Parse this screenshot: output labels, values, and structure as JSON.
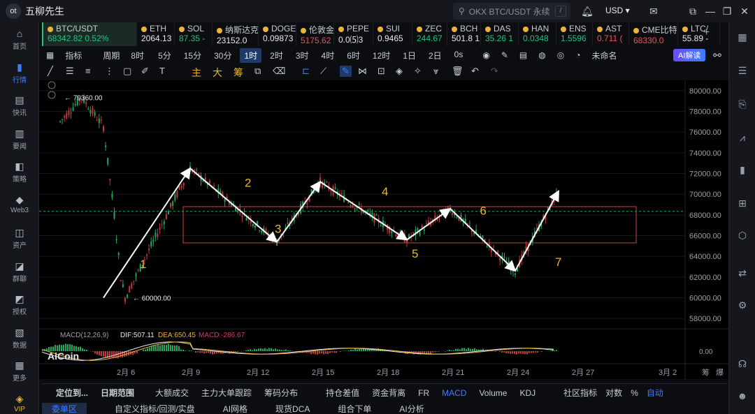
{
  "app": {
    "name": "五柳先生",
    "logo_text": "ot"
  },
  "search": {
    "placeholder": "OKX BTC/USDT 永续",
    "shortcut": "/"
  },
  "currency": "USD ▾",
  "sidebar": [
    {
      "label": "首页",
      "icon": "home-icon"
    },
    {
      "label": "行情",
      "icon": "market-icon",
      "active": true
    },
    {
      "label": "快讯",
      "icon": "news-flash-icon"
    },
    {
      "label": "要闻",
      "icon": "headline-icon"
    },
    {
      "label": "策略",
      "icon": "strategy-icon"
    },
    {
      "label": "Web3",
      "icon": "web3-icon"
    },
    {
      "label": "资产",
      "icon": "assets-icon"
    },
    {
      "label": "群聊",
      "icon": "chat-icon"
    },
    {
      "label": "授权",
      "icon": "authorize-icon"
    },
    {
      "label": "数据",
      "icon": "data-icon"
    },
    {
      "label": "更多",
      "icon": "more-icon"
    },
    {
      "label": "VIP",
      "icon": "vip-icon"
    }
  ],
  "tickers": [
    {
      "sym": "BTC/USDT",
      "price": "68342.82  0.52%",
      "color": "#26c281",
      "selected": true
    },
    {
      "sym": "ETH",
      "price": "2064.13",
      "color": "#e7e9ee"
    },
    {
      "sym": "SOL",
      "price": "87.35 -",
      "color": "#26c281"
    },
    {
      "sym": "纳斯达克",
      "price": "23152.0",
      "color": "#e7e9ee"
    },
    {
      "sym": "DOGE",
      "price": "0.09873",
      "color": "#e7e9ee"
    },
    {
      "sym": "伦敦金",
      "price": "5175.62",
      "color": "#f0505a"
    },
    {
      "sym": "PEPE",
      "price": "0.0⑸3",
      "color": "#e7e9ee"
    },
    {
      "sym": "SUI",
      "price": "0.9465",
      "color": "#e7e9ee"
    },
    {
      "sym": "ZEC",
      "price": "244.67",
      "color": "#26c281"
    },
    {
      "sym": "BCH",
      "price": "501.8 1",
      "color": "#e7e9ee"
    },
    {
      "sym": "DAS",
      "price": "35.26 1",
      "color": "#26c281"
    },
    {
      "sym": "HAN",
      "price": "0.0348",
      "color": "#26c281"
    },
    {
      "sym": "ENS",
      "price": "1.5596",
      "color": "#26c281"
    },
    {
      "sym": "AST",
      "price": "0.711 (",
      "color": "#f0505a"
    },
    {
      "sym": "CME比特",
      "price": "68330.0",
      "color": "#f0505a"
    },
    {
      "sym": "LTC/",
      "price": "55.89 -",
      "color": "#e7e9ee"
    }
  ],
  "toolbar": {
    "indicator": "指标",
    "period": "周期",
    "timeframes": [
      "8时",
      "5分",
      "15分",
      "30分",
      "1时",
      "2时",
      "3时",
      "4时",
      "6时",
      "12时",
      "1日",
      "2日",
      "0s"
    ],
    "active_tf": "1时",
    "layout_name": "未命名",
    "ai_label": "AI解读"
  },
  "draw_tools": {
    "chips": [
      "主",
      "大",
      "筹"
    ]
  },
  "chart_data": {
    "type": "line",
    "title": "",
    "y_ticks": [
      "80000.00",
      "78000.00",
      "76000.00",
      "74000.00",
      "72000.00",
      "70000.00",
      "68000.00",
      "66000.00",
      "64000.00",
      "62000.00",
      "60000.00",
      "58000.00"
    ],
    "x_ticks": [
      "2月 6",
      "2月 9",
      "2月 12",
      "2月 15",
      "2月 18",
      "2月 21",
      "2月 24",
      "2月 27",
      "3月 2"
    ],
    "ylim": [
      57000,
      81000
    ],
    "high_label": "79360.00",
    "low_label": "60000.00",
    "current_price_line": 68342.82,
    "range_box": {
      "top": 68800,
      "bottom": 65300
    },
    "wave_points": [
      {
        "x": "2月 5",
        "y": 60000
      },
      {
        "x": "2月 9",
        "y": 72500
      },
      {
        "x": "2月 13",
        "y": 65400
      },
      {
        "x": "2月 15",
        "y": 71200
      },
      {
        "x": "2月 19",
        "y": 65600
      },
      {
        "x": "2月 21",
        "y": 68600
      },
      {
        "x": "2月 24",
        "y": 62600
      },
      {
        "x": "2月 26",
        "y": 70300
      }
    ],
    "wave_labels": [
      "1",
      "2",
      "3",
      "4",
      "5",
      "6",
      "7"
    ],
    "macd": {
      "label": "MACD(12,26,9)",
      "dif": "DIF:507.11",
      "dea": "DEA:650.45",
      "macd": "MACD:-286.67",
      "zero": "0.00"
    },
    "watermark": "AiCoin"
  },
  "bottom_tabs": [
    "定位到...",
    "日期范围",
    "大额成交",
    "主力大单跟踪",
    "筹码分布",
    "持仓差值",
    "资金背离",
    "FR",
    "MACD",
    "Volume",
    "KDJ",
    "社区指标",
    "对数",
    "%",
    "自动"
  ],
  "bottom_tabs2": [
    "委单区",
    "自定义指标/回测/实盘",
    "AI网格",
    "现货DCA",
    "组合下单",
    "AI分析"
  ],
  "corner_labels": {
    "right_top": "筹",
    "right_top2": "爆"
  }
}
